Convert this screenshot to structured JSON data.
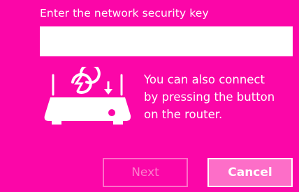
{
  "dialog": {
    "prompt_label": "Enter the network security key",
    "key_field": {
      "value": "",
      "placeholder": ""
    },
    "wps_hint": {
      "line1": "You can also connect",
      "line2": "by pressing the button",
      "line3": "on the router."
    },
    "illustration_icon": "router-wps-icon",
    "buttons": {
      "next_label": "Next",
      "next_enabled": false,
      "cancel_label": "Cancel"
    }
  },
  "colors": {
    "background": "#fb06a8",
    "text": "#ffffff",
    "disabled_text": "#fd7ecd",
    "cancel_fill": "#fd6ec8"
  }
}
